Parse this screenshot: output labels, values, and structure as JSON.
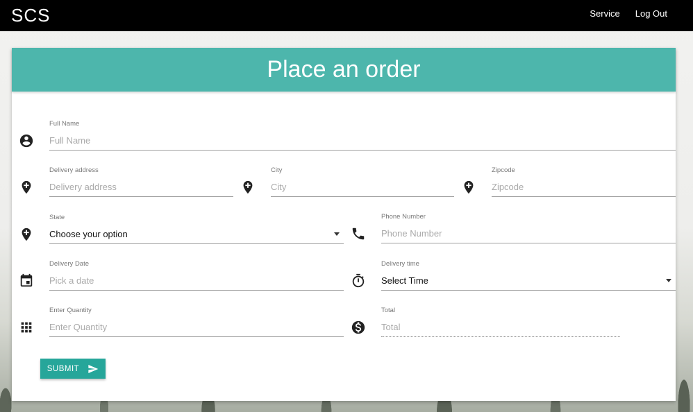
{
  "navbar": {
    "brand": "SCS",
    "links": [
      "Service",
      "Log Out"
    ]
  },
  "form": {
    "title": "Place an order",
    "fields": {
      "full_name": {
        "label": "Full Name",
        "placeholder": "Full Name",
        "icon": "account-circle-icon"
      },
      "delivery_address": {
        "label": "Delivery address",
        "placeholder": "Delivery address",
        "icon": "add-location-icon"
      },
      "city": {
        "label": "City",
        "placeholder": "City",
        "icon": "add-location-icon"
      },
      "zipcode": {
        "label": "Zipcode",
        "placeholder": "Zipcode",
        "icon": "add-location-icon"
      },
      "state": {
        "label": "State",
        "value": "Choose your option",
        "icon": "add-location-icon"
      },
      "phone": {
        "label": "Phone Number",
        "placeholder": "Phone Number",
        "icon": "phone-icon"
      },
      "delivery_date": {
        "label": "Delivery Date",
        "placeholder": "Pick a date",
        "icon": "calendar-icon"
      },
      "delivery_time": {
        "label": "Delivery time",
        "value": "Select Time",
        "icon": "timer-icon"
      },
      "quantity": {
        "label": "Enter Quantity",
        "placeholder": "Enter Quantity",
        "icon": "grid-icon"
      },
      "total": {
        "label": "Total",
        "placeholder": "Total",
        "icon": "dollar-icon"
      }
    },
    "submit_label": "SUBMIT"
  },
  "colors": {
    "navbar": "#000000",
    "header": "#4db6ac",
    "button": "#26a69a"
  }
}
